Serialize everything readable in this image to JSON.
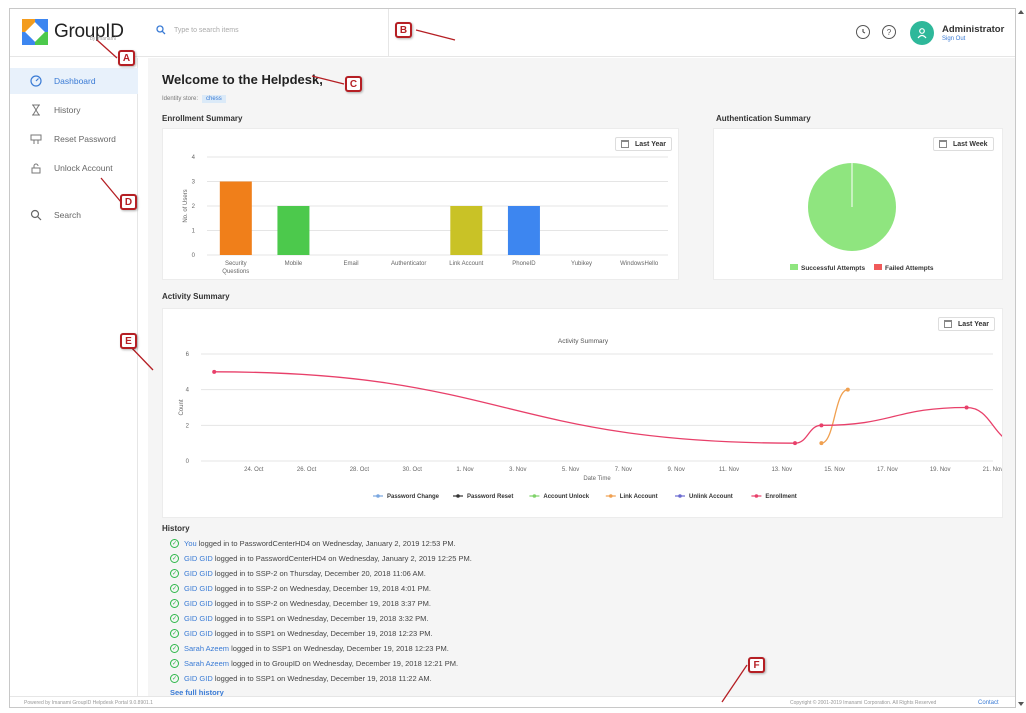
{
  "app": {
    "logo_text": "GroupID",
    "logo_sub": "by Imanami"
  },
  "header": {
    "search_placeholder": "Type to search items",
    "user_name": "Administrator",
    "sign_out": "Sign Out",
    "history_icon": "clock-icon",
    "help_icon": "help-icon",
    "help_glyph": "?"
  },
  "sidebar": {
    "items": [
      {
        "label": "Dashboard",
        "icon": "gauge-icon",
        "active": true
      },
      {
        "label": "History",
        "icon": "hourglass-icon",
        "active": false
      },
      {
        "label": "Reset Password",
        "icon": "keypad-icon",
        "active": false
      },
      {
        "label": "Unlock Account",
        "icon": "unlock-icon",
        "active": false
      },
      {
        "label": "Search",
        "icon": "search-icon",
        "active": false
      }
    ]
  },
  "main": {
    "welcome": "Welcome to the Helpdesk,",
    "identity_label": "Identity store:",
    "identity_value": "chess",
    "enrollment_title": "Enrollment Summary",
    "enrollment_period": "Last Year",
    "auth_title": "Authentication Summary",
    "auth_period": "Last Week",
    "activity_title": "Activity Summary",
    "activity_period": "Last Year"
  },
  "chart_data": [
    {
      "type": "bar",
      "ylabel": "No. of Users",
      "ylim": [
        0,
        4
      ],
      "yticks": [
        "0",
        "1",
        "2",
        "3",
        "4"
      ],
      "categories": [
        "Security Questions",
        "Mobile",
        "Email",
        "Authenticator",
        "Link Account",
        "PhoneID",
        "Yubikey",
        "WindowsHello"
      ],
      "category_lines": [
        [
          "Security",
          "Questions"
        ],
        [
          "Mobile"
        ],
        [
          "Email"
        ],
        [
          "Authenticator"
        ],
        [
          "Link Account"
        ],
        [
          "PhoneID"
        ],
        [
          "Yubikey"
        ],
        [
          "WindowsHello"
        ]
      ],
      "values": [
        3,
        2,
        0,
        0,
        2,
        2,
        0,
        0
      ],
      "colors": [
        "#f07f1a",
        "#4cc94c",
        "#999999",
        "#999999",
        "#c9c226",
        "#3d86f0",
        "#999999",
        "#999999"
      ],
      "grid": true
    },
    {
      "type": "pie",
      "labels": [
        "Successful Attempts",
        "Failed Attempts"
      ],
      "values": [
        100,
        0
      ],
      "colors": [
        "#8fe57f",
        "#f05a5a"
      ],
      "legend": "bottom"
    },
    {
      "type": "line",
      "title": "Activity Summary",
      "xlabel": "Date Time",
      "ylabel": "Count",
      "ylim": [
        0,
        6
      ],
      "yticks": [
        "0",
        "2",
        "4",
        "6"
      ],
      "xticks": [
        "24. Oct",
        "26. Oct",
        "28. Oct",
        "30. Oct",
        "1. Nov",
        "3. Nov",
        "5. Nov",
        "7. Nov",
        "9. Nov",
        "11. Nov",
        "13. Nov",
        "15. Nov",
        "17. Nov",
        "19. Nov",
        "21. Nov"
      ],
      "x_domain": [
        22,
        52
      ],
      "series": [
        {
          "name": "Password Change",
          "color": "#7aa7e0",
          "points": []
        },
        {
          "name": "Password Reset",
          "color": "#333333",
          "points": []
        },
        {
          "name": "Account Unlock",
          "color": "#7fd36a",
          "points": []
        },
        {
          "name": "Link Account",
          "color": "#f0a050",
          "points": [
            [
              45.5,
              1
            ],
            [
              46.5,
              4
            ]
          ]
        },
        {
          "name": "Unlink Account",
          "color": "#6a6ad0",
          "points": []
        },
        {
          "name": "Enrollment",
          "color": "#e8406a",
          "points": [
            [
              22.5,
              5
            ],
            [
              44.5,
              1
            ],
            [
              45.5,
              2
            ],
            [
              51,
              3
            ],
            [
              53,
              1
            ]
          ]
        }
      ],
      "legend": "bottom",
      "grid": true
    }
  ],
  "history": {
    "title": "History",
    "rows": [
      {
        "user": "You",
        "text": "logged in to PasswordCenterHD4 on Wednesday, January 2, 2019 12:53 PM."
      },
      {
        "user": "GID GID",
        "text": "logged in to PasswordCenterHD4 on Wednesday, January 2, 2019 12:25 PM."
      },
      {
        "user": "GID GID",
        "text": "logged in to SSP-2 on Thursday, December 20, 2018 11:06 AM."
      },
      {
        "user": "GID GID",
        "text": "logged in to SSP-2 on Wednesday, December 19, 2018 4:01 PM."
      },
      {
        "user": "GID GID",
        "text": "logged in to SSP-2 on Wednesday, December 19, 2018 3:37 PM."
      },
      {
        "user": "GID GID",
        "text": "logged in to SSP1 on Wednesday, December 19, 2018 3:32 PM."
      },
      {
        "user": "GID GID",
        "text": "logged in to SSP1 on Wednesday, December 19, 2018 12:23 PM."
      },
      {
        "user": "Sarah Azeem",
        "text": "logged in to SSP1 on Wednesday, December 19, 2018 12:23 PM."
      },
      {
        "user": "Sarah Azeem",
        "text": "logged in to GroupID on Wednesday, December 19, 2018 12:21 PM."
      },
      {
        "user": "GID GID",
        "text": "logged in to SSP1 on Wednesday, December 19, 2018 11:22 AM."
      }
    ],
    "see_full": "See full history"
  },
  "footer": {
    "left": "Powered by Imanami GroupID Helpdesk Portal 9.0.8901.1",
    "right": "Copyright © 2001-2019 Imanami Corporation. All Rights Reserved",
    "contact": "Contact"
  },
  "callouts": [
    "A",
    "B",
    "C",
    "D",
    "E",
    "F"
  ],
  "colors": {
    "accent": "#3a7bd5",
    "callout": "#b51f24",
    "avatar": "#2eb89a"
  }
}
